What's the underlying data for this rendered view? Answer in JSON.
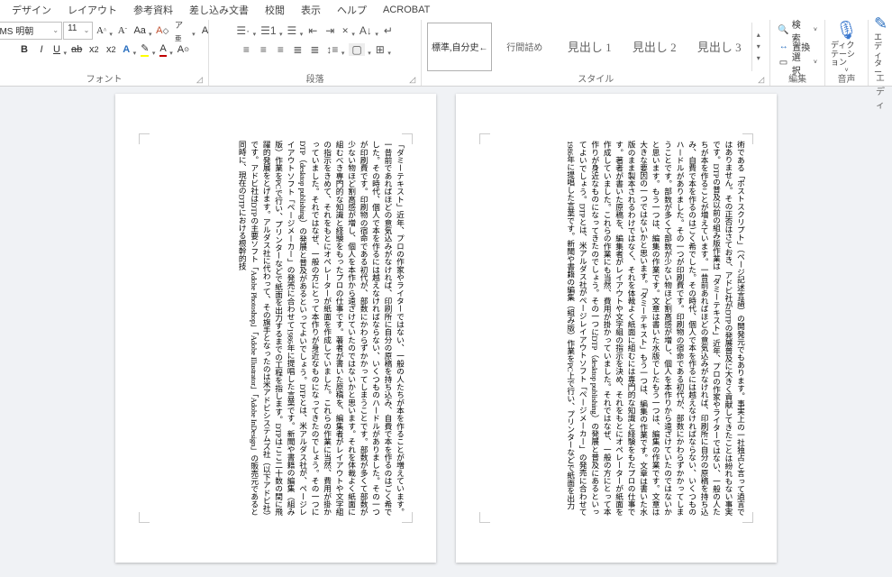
{
  "menu": [
    "デザイン",
    "レイアウト",
    "参考資料",
    "差し込み文書",
    "校閲",
    "表示",
    "ヘルプ",
    "ACROBAT"
  ],
  "font": {
    "name": "MS 明朝",
    "size": "11"
  },
  "groups": {
    "font": "フォント",
    "paragraph": "段落",
    "styles": "スタイル",
    "editing": "編集",
    "voice": "音声",
    "editor": "エディ"
  },
  "styles": {
    "items": [
      "標準,自分史←",
      "行間詰め",
      "見出し 1",
      "見出し 2",
      "見出し 3"
    ]
  },
  "editing": {
    "find": "検索",
    "replace": "置換",
    "select": "選択"
  },
  "voice": {
    "label": "ディクテーション"
  },
  "editor": {
    "label": "エディター"
  },
  "page1": "「ダミーテキスト」近年、プロの作家やライターではない、一般の人たちが本を作ることが増えています。一昔前であればほどの意気込みがなければ、印刷所に自分の原稿を持ち込み、自費で本を作るのはごく希でした。その時代、個人で本を作るには越えなければならない、いくつものハードルがありました。その一つが印刷費です。印刷物の宿命である初代が、部数にかわらずかかってしまうことです。部数が多くて部数が少ない物ほど割高感が増し、個人を本作から遠ざけていたのではないかと思います。それを体裁よく紙面に組むべき専門的な知識と経験をもったプロの仕事です。著者が書いた原稿を、編集者がレイアウトや文字組の指示をきめて、それをもとにオペレーターが紙面を作成していました。これらの作業に当然、費用が掛かっていました。それではなぜ、一般の方にとって本作りが身近なものになってきたのでしょう。その一つにDTP（desktop publishing）の発展と普及があるといってよいでしょう。DTPとは、米アルダス社が、ページレイアウトソフト「ページメーカー」の発売に合わせて1986年に提唱した言葉です。新聞や書籍の編集（組み版）作業をPCで行い、プリンターなどで紙面を出力するまでの工程を指します。DTPはここ二十数の間に飛躍的発展をとげます。アルダス社に代わって、その旗手となったのは米アドビシステムズ社（以下アドビ社）です。アドビ社はDTPの主要ソフト「Adobe Photoshop」「Adobe Illustrator」「Adobe InDesign」の販売元であると同時に、現在のDTPにおける根幹的技",
  "page2": "術である「ポストスクリプト」（ページ記述言語）の開発元でもあります。事実上の一社独占と言って過言ではありません。その正否はさておき、アドビ社がDTPの発展普及に大きく貢献してきたことは紛れもない事実です。DTPの普及以前の組み版作業は「ダミーテキスト」近年、プロの作家やライターではない、一般の人たちが本を作ることが増えています。一昔前あればほどの意気込みがなければ、印刷所に自分の原稿を持ち込み、自費で本を作るのはごく希でした。その時代、個人で本を作るには越えなければならない、いくつものハードルがありました。その一つが印刷費です。印刷物の宿命である初代が、部数にかわらずかかってしまうことです。部数が多くて部数が少ない物ほど割高感が増し、個人を本作りから遠ざけていたのではないかと思います。もう一つは、編集の作業です。文章は書いた水版でしたもう一つは、編集の作業です。文章は大きな要因の一つではないかと思います。「ダミーテキスト」もう一つは、編集の作業です。文章は書いた水版のまま製本されるわけではなく、それを体裁よく紙面に組むには専門的な知識と経験をもたプロの仕事です。著者が書いた原稿を、編集者がレイアウトや文字組の指示を決め、それをもとにオペレーターが紙面を作成していました。これらの作業にも当然、費用が掛かっていました。それではなぜ、一般の方にとって本作りが身近なものになってきたのでしょう。その一つにDTP（desktop publishing）の発展と普及にあるといってよいでしょう。DTPとは、米アルダス社がページレイアウトソフト「ページメーカー」の発売に合わせて1986年に提唱した言葉です。新聞や書籍の編集（組み版）作業をPC上で行い、プリンターなどで紙面を出力"
}
